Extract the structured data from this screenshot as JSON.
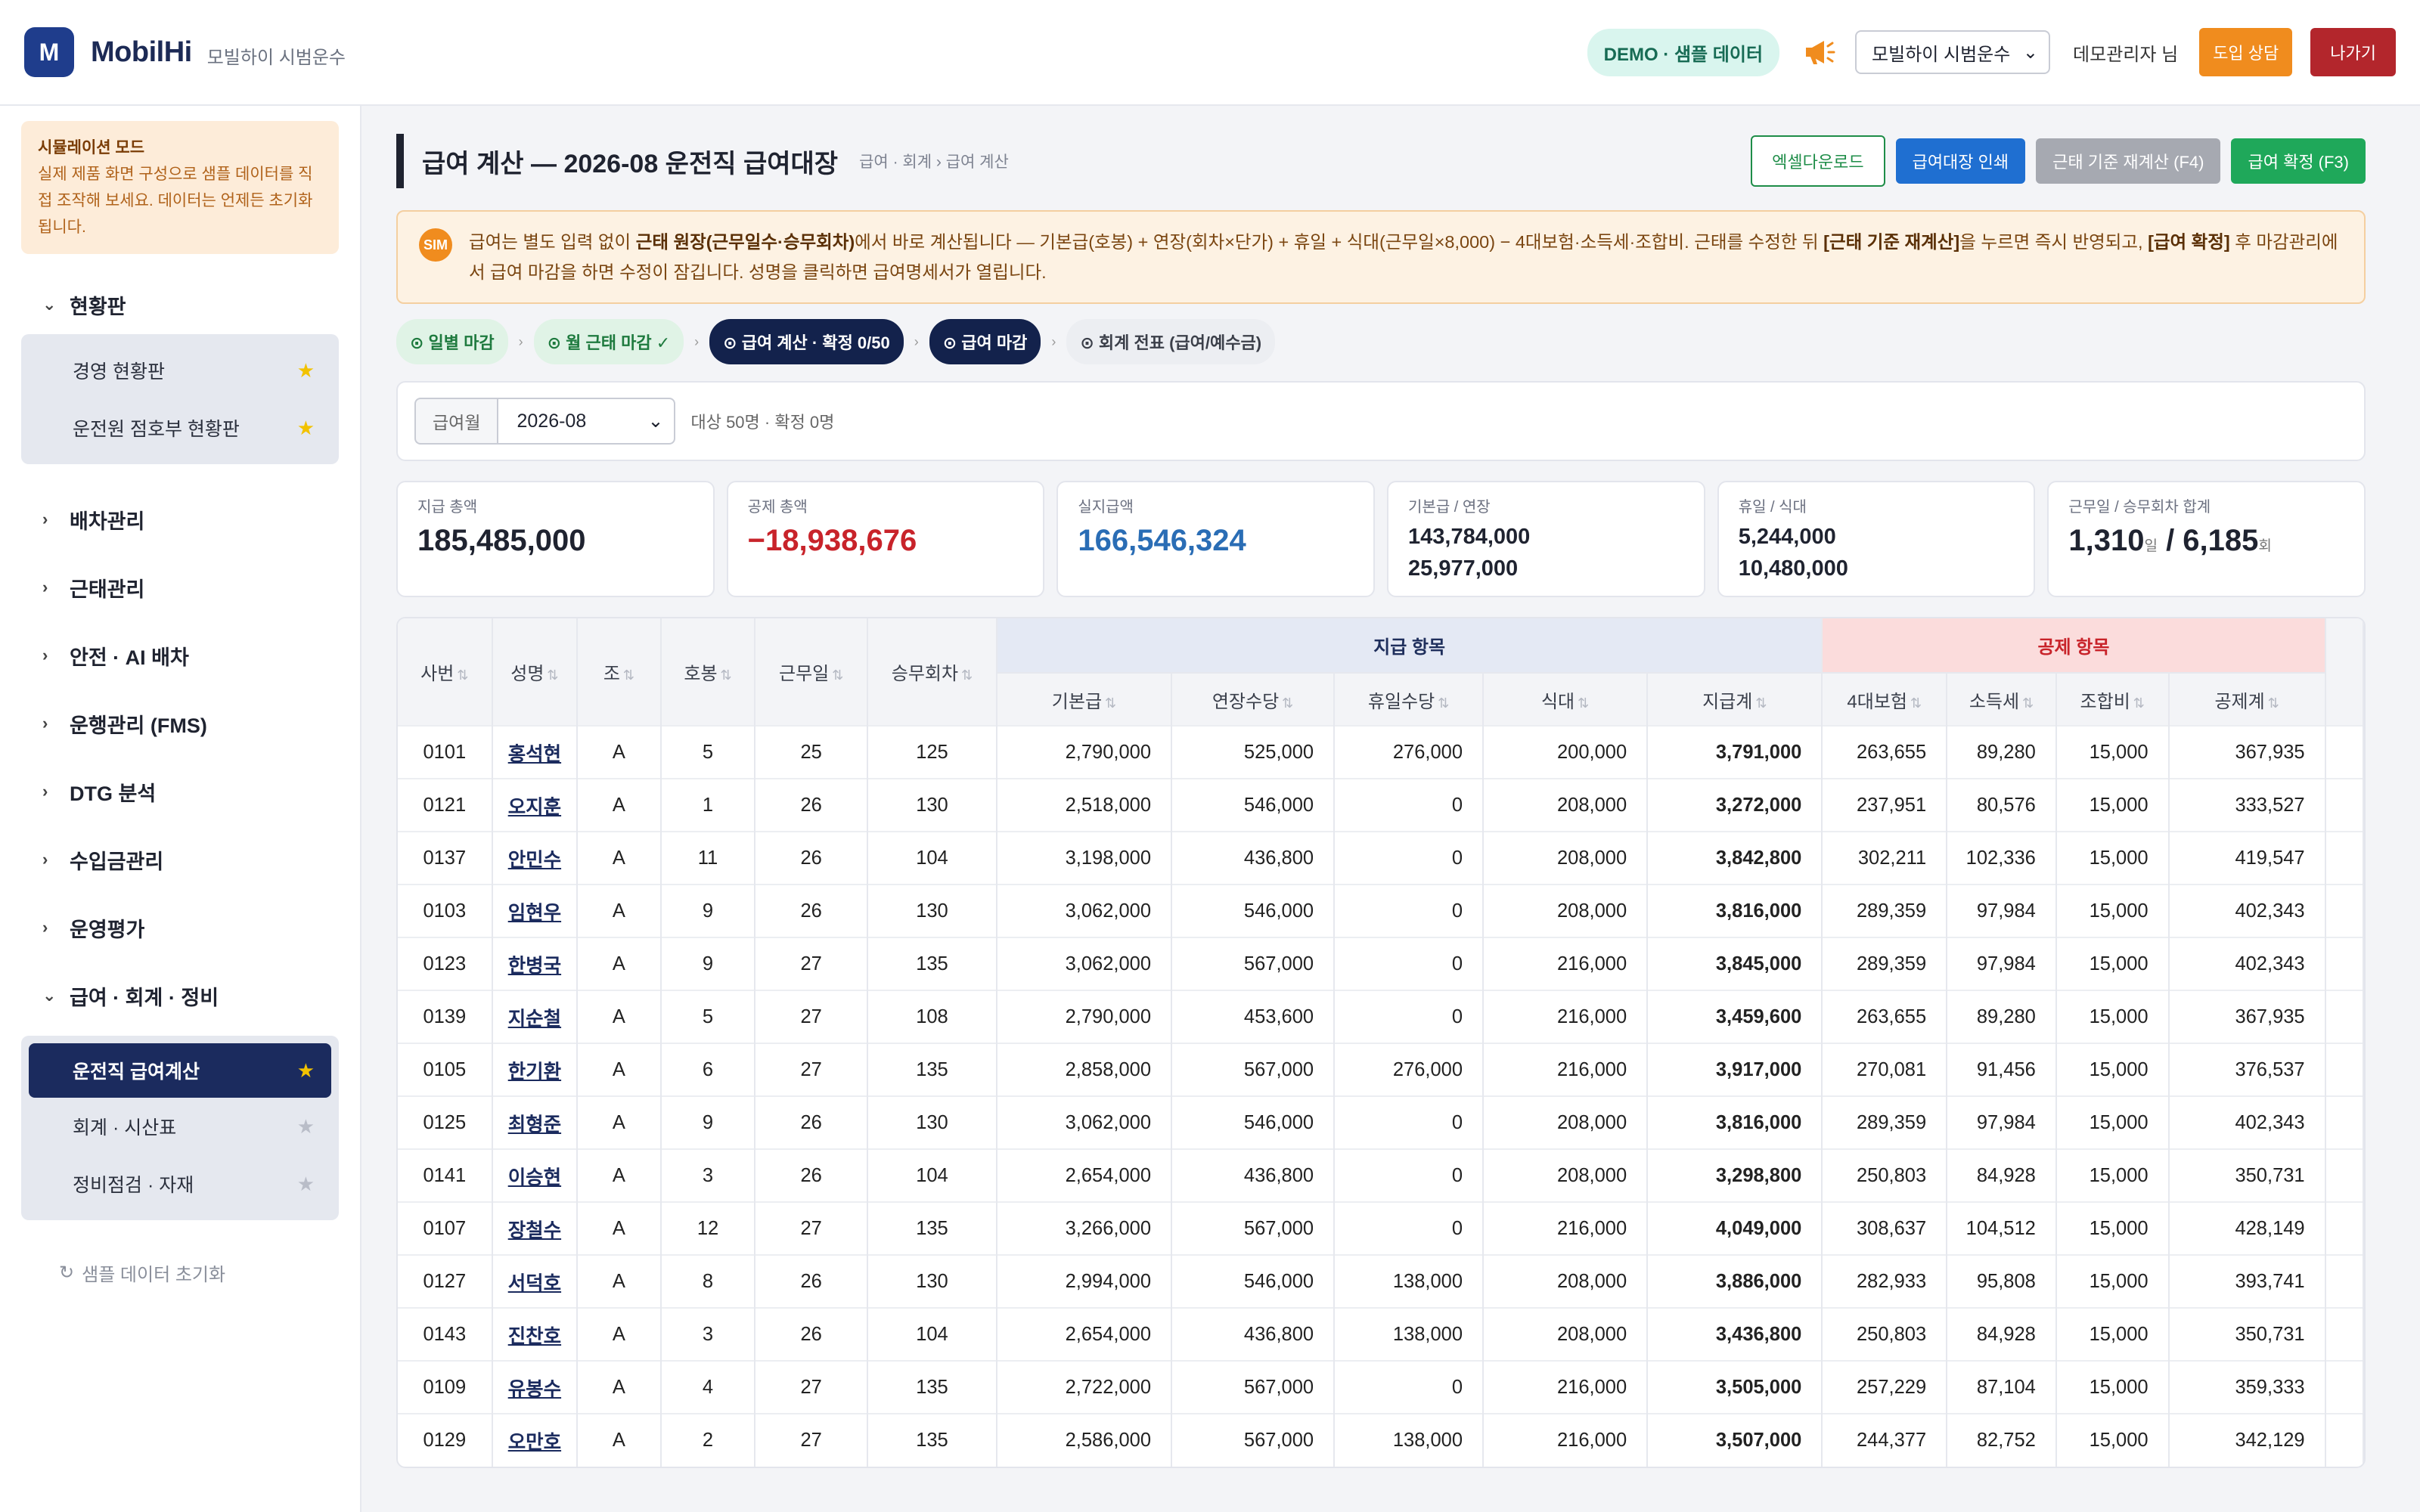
{
  "header": {
    "logo_letter": "M",
    "brand": "MobilHi",
    "brand_sub": "모빌하이 시범운수",
    "demo_badge": "DEMO · 샘플 데이터",
    "company_select": "모빌하이 시범운수",
    "user": "데모관리자 님",
    "consult_btn": "도입 상담",
    "exit_btn": "나가기"
  },
  "sidebar": {
    "sim_title": "시뮬레이션 모드",
    "sim_body": "실제 제품 화면 구성으로 샘플 데이터를 직접 조작해 보세요. 데이터는 언제든 초기화됩니다.",
    "group_status": "현황판",
    "status_items": [
      {
        "label": "경영 현황판"
      },
      {
        "label": "운전원 점호부 현황판"
      }
    ],
    "groups": [
      "배차관리",
      "근태관리",
      "안전 · AI 배차",
      "운행관리 (FMS)",
      "DTG 분석",
      "수입금관리",
      "운영평가"
    ],
    "group_pay": "급여 · 회계 · 정비",
    "pay_items": [
      {
        "label": "운전직 급여계산"
      },
      {
        "label": "회계 · 시산표"
      },
      {
        "label": "정비점검 · 자재"
      }
    ],
    "reset": "샘플 데이터 초기화"
  },
  "main": {
    "title": "급여 계산 — 2026-08 운전직 급여대장",
    "crumb": "급여 · 회계 › 급여 계산",
    "btn_excel": "엑셀다운로드",
    "btn_print": "급여대장 인쇄",
    "btn_recalc": "근태 기준 재계산 (F4)",
    "btn_confirm": "급여 확정 (F3)",
    "notice": {
      "ico": "SIM",
      "t1": "급여는 별도 입력 없이 ",
      "b1": "근태 원장(근무일수·승무회차)",
      "t2": "에서 바로 계산됩니다 — 기본급(호봉) + 연장(회차×단가) + 휴일 + 식대(근무일×8,000) − 4대보험·소득세·조합비. 근태를 수정한 뒤 ",
      "b2": "[근태 기준 재계산]",
      "t3": "을 누르면 즉시 반영되고, ",
      "b3": "[급여 확정]",
      "t4": " 후 마감관리에서 급여 마감을 하면 수정이 잠깁니다. 성명을 클릭하면 급여명세서가 열립니다."
    },
    "steps": [
      "⊙ 일별 마감",
      "⊙ 월 근태 마감 ✓",
      "⊙ 급여 계산 · 확정 0/50",
      "⊙ 급여 마감",
      "⊙ 회계 전표 (급여/예수금)"
    ],
    "filter_label": "급여월",
    "filter_value": "2026-08",
    "filter_note": "대상 50명 · 확정 0명",
    "cards": {
      "pay_total_label": "지급 총액",
      "pay_total": "185,485,000",
      "ded_total_label": "공제 총액",
      "ded_total": "−18,938,676",
      "net_label": "실지급액",
      "net": "166,546,324",
      "base_label": "기본급 / 연장",
      "base": "143,784,000",
      "ext": "25,977,000",
      "hol_label": "휴일 / 식대",
      "hol": "5,244,000",
      "meal": "10,480,000",
      "work_label": "근무일 / 승무회차 합계",
      "days": "1,310",
      "days_unit": "일",
      "sep": " / ",
      "runs": "6,185",
      "runs_unit": "회"
    },
    "table": {
      "group_pay": "지급 항목",
      "group_ded": "공제 항목",
      "headers": [
        "사번",
        "성명",
        "조",
        "호봉",
        "근무일",
        "승무회차",
        "기본급",
        "연장수당",
        "휴일수당",
        "식대",
        "지급계",
        "4대보험",
        "소득세",
        "조합비",
        "공제계"
      ],
      "rows": [
        [
          "0101",
          "홍석현",
          "A",
          "5",
          "25",
          "125",
          "2,790,000",
          "525,000",
          "276,000",
          "200,000",
          "3,791,000",
          "263,655",
          "89,280",
          "15,000",
          "367,935"
        ],
        [
          "0121",
          "오지훈",
          "A",
          "1",
          "26",
          "130",
          "2,518,000",
          "546,000",
          "0",
          "208,000",
          "3,272,000",
          "237,951",
          "80,576",
          "15,000",
          "333,527"
        ],
        [
          "0137",
          "안민수",
          "A",
          "11",
          "26",
          "104",
          "3,198,000",
          "436,800",
          "0",
          "208,000",
          "3,842,800",
          "302,211",
          "102,336",
          "15,000",
          "419,547"
        ],
        [
          "0103",
          "임현우",
          "A",
          "9",
          "26",
          "130",
          "3,062,000",
          "546,000",
          "0",
          "208,000",
          "3,816,000",
          "289,359",
          "97,984",
          "15,000",
          "402,343"
        ],
        [
          "0123",
          "한병국",
          "A",
          "9",
          "27",
          "135",
          "3,062,000",
          "567,000",
          "0",
          "216,000",
          "3,845,000",
          "289,359",
          "97,984",
          "15,000",
          "402,343"
        ],
        [
          "0139",
          "지순철",
          "A",
          "5",
          "27",
          "108",
          "2,790,000",
          "453,600",
          "0",
          "216,000",
          "3,459,600",
          "263,655",
          "89,280",
          "15,000",
          "367,935"
        ],
        [
          "0105",
          "한기환",
          "A",
          "6",
          "27",
          "135",
          "2,858,000",
          "567,000",
          "276,000",
          "216,000",
          "3,917,000",
          "270,081",
          "91,456",
          "15,000",
          "376,537"
        ],
        [
          "0125",
          "최형준",
          "A",
          "9",
          "26",
          "130",
          "3,062,000",
          "546,000",
          "0",
          "208,000",
          "3,816,000",
          "289,359",
          "97,984",
          "15,000",
          "402,343"
        ],
        [
          "0141",
          "이승현",
          "A",
          "3",
          "26",
          "104",
          "2,654,000",
          "436,800",
          "0",
          "208,000",
          "3,298,800",
          "250,803",
          "84,928",
          "15,000",
          "350,731"
        ],
        [
          "0107",
          "장철수",
          "A",
          "12",
          "27",
          "135",
          "3,266,000",
          "567,000",
          "0",
          "216,000",
          "4,049,000",
          "308,637",
          "104,512",
          "15,000",
          "428,149"
        ],
        [
          "0127",
          "서덕호",
          "A",
          "8",
          "26",
          "130",
          "2,994,000",
          "546,000",
          "138,000",
          "208,000",
          "3,886,000",
          "282,933",
          "95,808",
          "15,000",
          "393,741"
        ],
        [
          "0143",
          "진찬호",
          "A",
          "3",
          "26",
          "104",
          "2,654,000",
          "436,800",
          "138,000",
          "208,000",
          "3,436,800",
          "250,803",
          "84,928",
          "15,000",
          "350,731"
        ],
        [
          "0109",
          "유봉수",
          "A",
          "4",
          "27",
          "135",
          "2,722,000",
          "567,000",
          "0",
          "216,000",
          "3,505,000",
          "257,229",
          "87,104",
          "15,000",
          "359,333"
        ],
        [
          "0129",
          "오만호",
          "A",
          "2",
          "27",
          "135",
          "2,586,000",
          "567,000",
          "138,000",
          "216,000",
          "3,507,000",
          "244,377",
          "82,752",
          "15,000",
          "342,129"
        ]
      ]
    }
  },
  "colors": {
    "accent": "#1b2b5e",
    "deduction": "#c8232a",
    "net": "#2a6db5",
    "confirm": "#1fa85a",
    "warn": "#f08c1e"
  }
}
